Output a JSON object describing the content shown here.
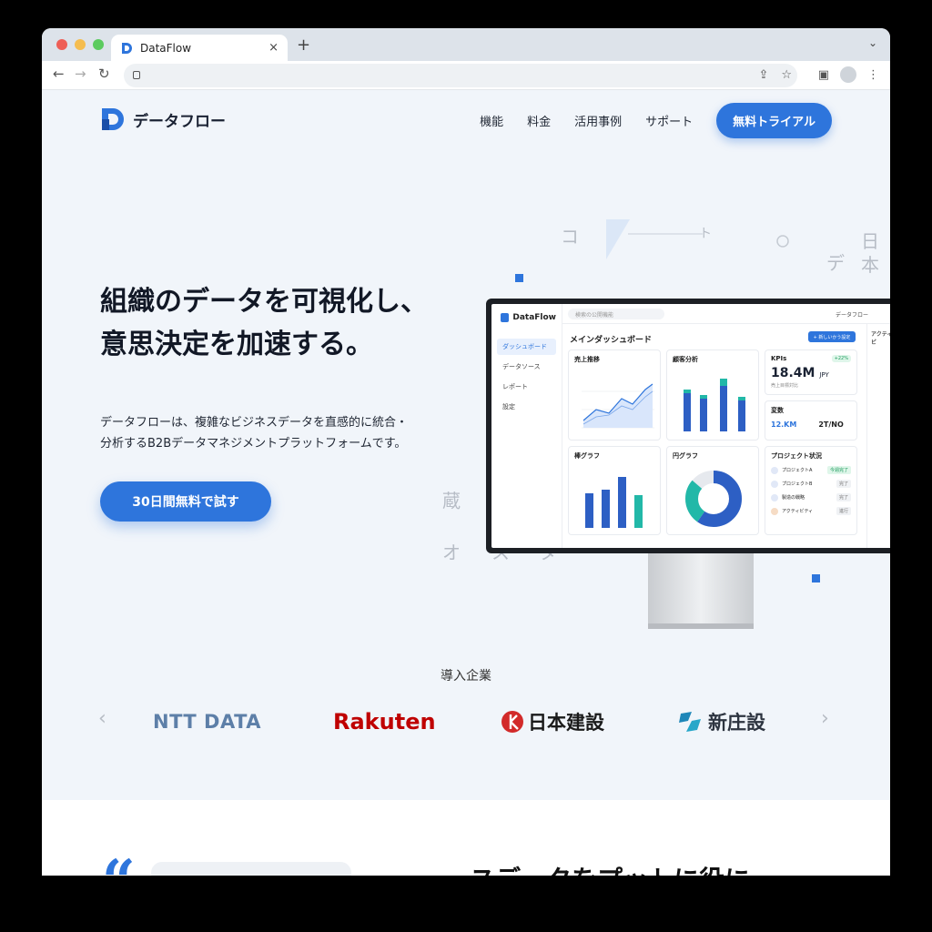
{
  "browser": {
    "tab_title": "DataFlow",
    "new_tab": "+",
    "tab_close": "×"
  },
  "header": {
    "logo_text": "データフロー",
    "nav": [
      "機能",
      "料金",
      "活用事例",
      "サポート"
    ],
    "cta": "無料トライアル"
  },
  "hero": {
    "title_line1": "組織のデータを可視化し、",
    "title_line2": "意思決定を加速する。",
    "subtitle_line1": "データフローは、複雑なビジネスデータを直感的に統合・",
    "subtitle_line2": "分析するB2Bデータマネジメントプラットフォームです。",
    "button": "30日間無料で試す"
  },
  "decor": {
    "chars": [
      "コ",
      "ト",
      "日",
      "デ",
      "本",
      "蔵",
      "オ",
      "ス",
      "タ"
    ]
  },
  "dashboard": {
    "logo": "DataFlow",
    "search_placeholder": "検索の公開機能",
    "user": "データフロー",
    "nav": [
      "ダッシュボード",
      "データソース",
      "レポート",
      "設定"
    ],
    "title": "メインダッシュボード",
    "add_button": "+ 新しいかう設定",
    "cards": {
      "sales": "売上推移",
      "amount": "顧客分析",
      "kpi": "KPIs",
      "kpi_value": "18.4M",
      "kpi_unit": "JPY",
      "kpi_badge": "+22%",
      "kpi_sub": "売上目標対比",
      "vars": "変数",
      "vars_a": "12.KM",
      "vars_b": "2T/NO",
      "bar": "棒グラフ",
      "pie": "円グラフ",
      "project": "プロジェクト状況"
    },
    "projects": [
      {
        "name": "プロジェクトA",
        "tag": "今週完了"
      },
      {
        "name": "プロジェクトB",
        "tag": "完了"
      },
      {
        "name": "製造の戦略",
        "tag": "完了"
      },
      {
        "name": "アクティビティ",
        "tag": "進行"
      }
    ],
    "right_title": "アクティビ"
  },
  "clients": {
    "title": "導入企業",
    "logos": [
      "NTT DATA",
      "Rakuten",
      "日本建設",
      "新庄設"
    ],
    "prev": "‹",
    "next": "›"
  },
  "lower": {
    "quote": "“",
    "heading": "スデータをプットに役に"
  },
  "colors": {
    "accent": "#2e75dc",
    "teal": "#22b8a8",
    "rakuten": "#bf0000"
  }
}
